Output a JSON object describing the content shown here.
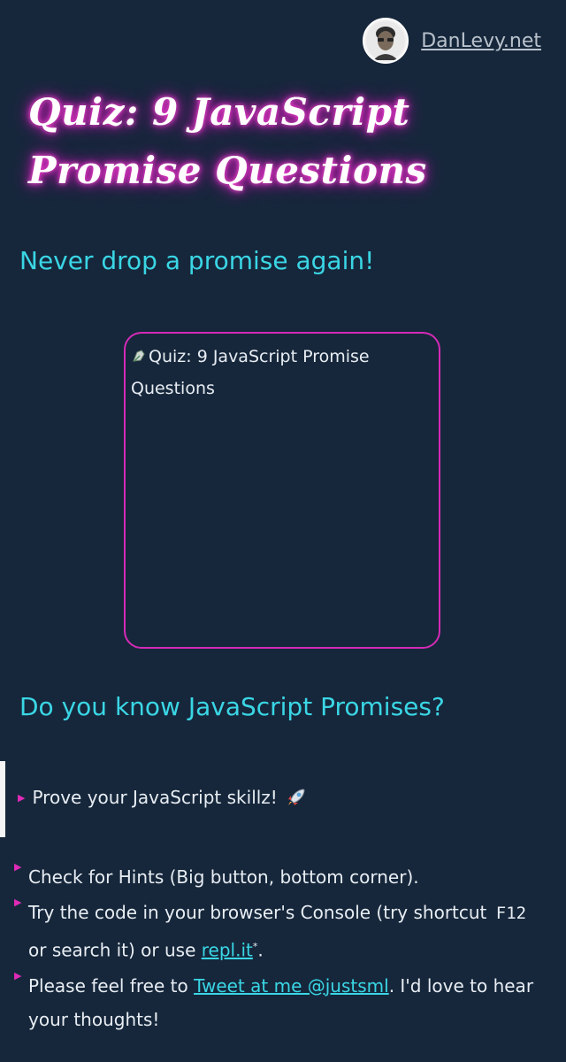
{
  "header": {
    "site_link": "DanLevy.net"
  },
  "title": {
    "line1": "Quiz: 9 JavaScript",
    "line2": "Promise Questions"
  },
  "subtitle": "Never drop a promise again!",
  "hero_image": {
    "alt": "Quiz: 9 JavaScript Promise Questions"
  },
  "section_heading": "Do you know JavaScript Promises?",
  "highlight": {
    "text": "Prove your JavaScript skillz!",
    "emoji": "🚀"
  },
  "tips": {
    "hints": "Check for Hints (Big button, bottom corner).",
    "console_prefix": "Try the code in your browser's Console (try shortcut",
    "console_key": "F12",
    "console_mid": "or search it) or use",
    "replit_link": "repl.it",
    "replit_mark": "*",
    "console_end": ".",
    "tweet_prefix": "Please feel free to",
    "tweet_link": "Tweet at me @justsml",
    "tweet_suffix": ". I'd love to hear your thoughts!"
  },
  "colors": {
    "background": "#16273b",
    "accent_cyan": "#3ad6e5",
    "accent_pink": "#d42bb6"
  }
}
